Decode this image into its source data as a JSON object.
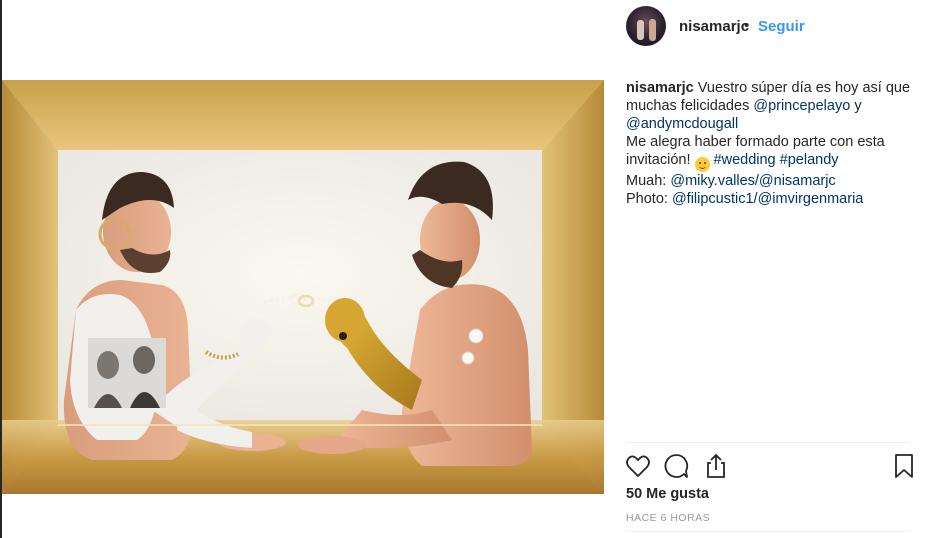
{
  "post": {
    "username": "nisamarjc",
    "separator": "•",
    "follow_label": "Seguir",
    "image_description": "Two shirtless men seated facing each other at a golden table inside a golden box, connecting hands with a small chain",
    "caption": {
      "username": "nisamarjc",
      "line1_text": " Vuestro súper día es hoy así que",
      "line2_text": "muchas felicidades ",
      "line2_mention": "@princepelayo",
      "line2_tail": " y",
      "line3_mention": "@andymcdougall",
      "line4_text": "Me alegra haber formado parte con esta",
      "line5_text": "invitación! ",
      "line5_emoji": "😊",
      "line5_tag1": "#wedding",
      "line5_tag2": "#pelandy",
      "line6_text": "Muah: ",
      "line6_mention": "@miky.valles/@nisamarjc",
      "line7_text": "Photo: ",
      "line7_mention": "@filipcustic1/@imvirgenmaria"
    },
    "likes": "50 Me gusta",
    "timestamp": "HACE 6 HORAS",
    "actions": {
      "like_icon": "heart-icon",
      "comment_icon": "comment-icon",
      "share_icon": "share-icon",
      "save_icon": "bookmark-icon"
    }
  },
  "colors": {
    "link": "#003569",
    "follow": "#3897f0",
    "text": "#262626",
    "muted": "#999999",
    "gold": "#c9a24a"
  }
}
